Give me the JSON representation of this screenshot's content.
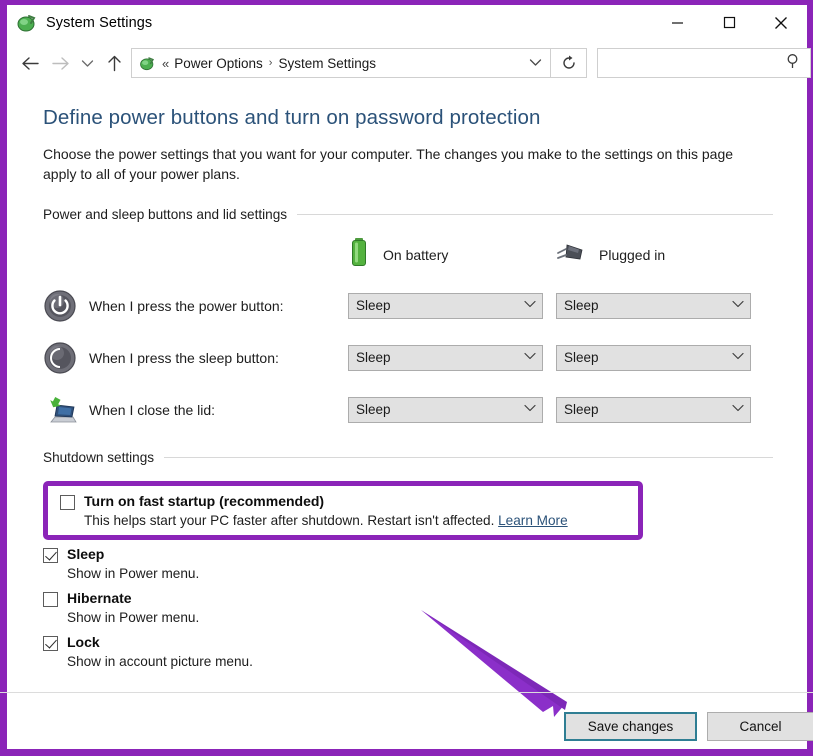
{
  "window": {
    "title": "System Settings",
    "app_icon": "power-options-icon",
    "controls": {
      "minimize": "minimize-icon",
      "maximize": "maximize-icon",
      "close": "close-icon"
    }
  },
  "navbar": {
    "back": "back-arrow-icon",
    "forward": "forward-arrow-icon",
    "recent": "chevron-down-icon",
    "up": "up-arrow-icon",
    "breadcrumb": {
      "icon": "power-options-icon",
      "overflow": "«",
      "items": [
        "Power Options",
        "System Settings"
      ],
      "separator": "›",
      "dropdown": "chevron-down-icon"
    },
    "refresh": "refresh-icon",
    "search": {
      "value": "",
      "placeholder": "",
      "icon": "search-icon"
    }
  },
  "page": {
    "title": "Define power buttons and turn on password protection",
    "description": "Choose the power settings that you want for your computer. The changes you make to the settings on this page apply to all of your power plans."
  },
  "power_group": {
    "heading": "Power and sleep buttons and lid settings",
    "columns": [
      {
        "label": "On battery",
        "icon": "battery-icon"
      },
      {
        "label": "Plugged in",
        "icon": "power-plug-icon"
      }
    ],
    "rows": [
      {
        "icon": "power-button-icon",
        "label": "When I press the power button:",
        "on_battery": "Sleep",
        "plugged_in": "Sleep"
      },
      {
        "icon": "sleep-button-icon",
        "label": "When I press the sleep button:",
        "on_battery": "Sleep",
        "plugged_in": "Sleep"
      },
      {
        "icon": "laptop-lid-icon",
        "label": "When I close the lid:",
        "on_battery": "Sleep",
        "plugged_in": "Sleep"
      }
    ]
  },
  "shutdown_group": {
    "heading": "Shutdown settings",
    "items": [
      {
        "label": "Turn on fast startup (recommended)",
        "checked": false,
        "sub": "This helps start your PC faster after shutdown. Restart isn't affected.",
        "link": "Learn More",
        "highlighted": true
      },
      {
        "label": "Sleep",
        "checked": true,
        "sub": "Show in Power menu.",
        "link": "",
        "highlighted": false
      },
      {
        "label": "Hibernate",
        "checked": false,
        "sub": "Show in Power menu.",
        "link": "",
        "highlighted": false
      },
      {
        "label": "Lock",
        "checked": true,
        "sub": "Show in account picture menu.",
        "link": "",
        "highlighted": false
      }
    ]
  },
  "footer": {
    "save_label": "Save changes",
    "cancel_label": "Cancel"
  },
  "annotations": {
    "accent_purple": "#8b24b8",
    "focus_border": "#2f7e93",
    "arrow": "annotation-arrow"
  }
}
